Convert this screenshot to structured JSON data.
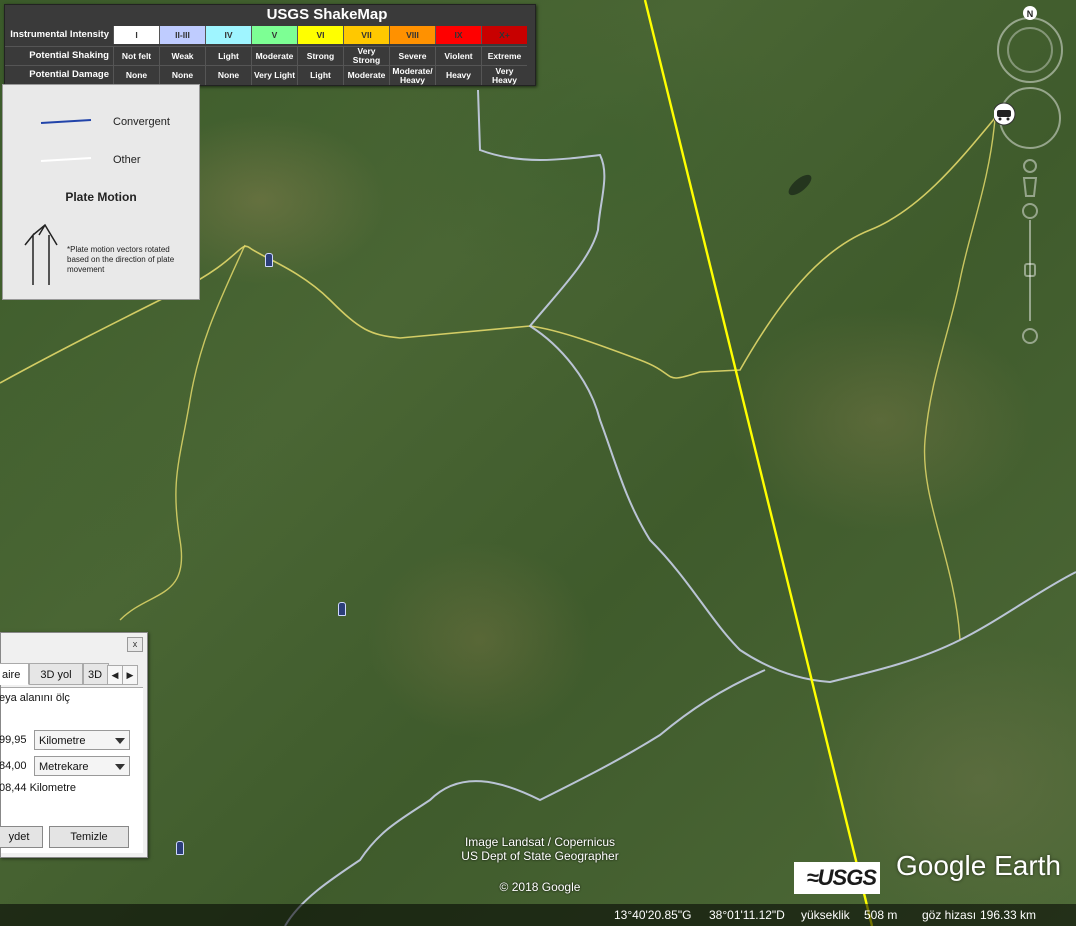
{
  "shakemap": {
    "title": "USGS ShakeMap",
    "row_labels": {
      "intensity": "Instrumental Intensity",
      "shaking": "Potential Shaking",
      "damage": "Potential Damage"
    },
    "levels": [
      {
        "intensity": "I",
        "shaking": "Not felt",
        "damage": "None",
        "color": "#ffffff"
      },
      {
        "intensity": "II-III",
        "shaking": "Weak",
        "damage": "None",
        "color": "#bfccff"
      },
      {
        "intensity": "IV",
        "shaking": "Light",
        "damage": "None",
        "color": "#9ff5ff"
      },
      {
        "intensity": "V",
        "shaking": "Moderate",
        "damage": "Very Light",
        "color": "#7dff94"
      },
      {
        "intensity": "VI",
        "shaking": "Strong",
        "damage": "Light",
        "color": "#ffff00"
      },
      {
        "intensity": "VII",
        "shaking": "Very Strong",
        "damage": "Moderate",
        "color": "#ffc800"
      },
      {
        "intensity": "VIII",
        "shaking": "Severe",
        "damage": "Moderate/ Heavy",
        "color": "#ff9100"
      },
      {
        "intensity": "IX",
        "shaking": "Violent",
        "damage": "Heavy",
        "color": "#ff0000"
      },
      {
        "intensity": "X+",
        "shaking": "Extreme",
        "damage": "Very Heavy",
        "color": "#c80000"
      }
    ]
  },
  "plate_legend": {
    "convergent": "Convergent",
    "other": "Other",
    "plate_motion": "Plate Motion",
    "note": "*Plate motion vectors rotated based on the direction of plate movement",
    "convergent_color": "#2244aa",
    "other_color": "#ffffff"
  },
  "measure_dialog": {
    "close": "x",
    "tabs": [
      "aire",
      "3D yol",
      "3D"
    ],
    "instruction": "eya alanını ölç",
    "perimeter_value": "99,95",
    "perimeter_unit": "Kilometre",
    "area_value": "84,00",
    "area_unit": "Metrekare",
    "extra_value": "08,44 Kilometre",
    "save_button": "ydet",
    "clear_button": "Temizle"
  },
  "attribution": {
    "line1": "Image Landsat / Copernicus",
    "line2": "US Dept of State Geographer",
    "copyright": "© 2018 Google",
    "usgs_logo": "≈USGS",
    "google_earth": "Google Earth"
  },
  "status": {
    "latitude": "13°40'20.85\"G",
    "longitude": "38°01'11.12\"D",
    "elevation_label": "yükseklik",
    "elevation_value": "508 m",
    "eye_label": "göz hizası",
    "eye_value": "196.33 km"
  },
  "nav": {
    "north_label": "N"
  },
  "colors": {
    "road": "#e8dc5a",
    "boundary": "#c8cfe8",
    "fault_line": "#ffff00"
  }
}
